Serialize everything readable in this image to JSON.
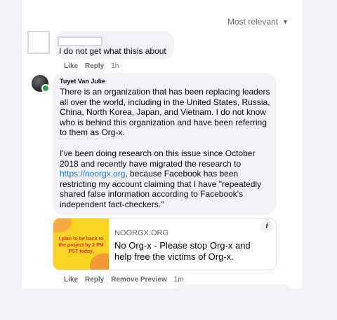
{
  "sort": {
    "label": "Most relevant"
  },
  "comments": [
    {
      "name": "",
      "text": "I do not get what thisis about",
      "actions": {
        "like": "Like",
        "reply": "Reply",
        "time": "1h"
      }
    },
    {
      "name": "Tuyet Van Julie",
      "paragraph1": "There is an organization that has been replacing leaders all over the world, including in the United States, Russia, China, North Korea, Japan, and Vietnam. I do not know who is behind this organization and have been referring to them as Org-x.",
      "paragraph2_before": "I've been doing research on this issue since October 2018 and recently have migrated the research to ",
      "paragraph2_link": "https://noorgx.org",
      "paragraph2_after": ", because Facebook has been restricting my account claiming that I have \"repeatedly shared false information according to Facebook's independent fact-checkers.\"",
      "preview": {
        "thumbnail_text": "I plan to be back to the project by 2 PM PST today.",
        "domain": "NOORGX.ORG",
        "title": "No Org-x - Please stop Org-x and help free the victims of Org-x.",
        "info_icon": "i"
      },
      "actions": {
        "like": "Like",
        "reply": "Reply",
        "remove_preview": "Remove Preview",
        "time": "1m"
      }
    }
  ],
  "icons": {
    "sort_caret": "chevron-down-icon",
    "info": "info-icon",
    "online": "online-status-icon"
  },
  "colors": {
    "link": "#216fdb",
    "online": "#31a24c",
    "thumbnail_bg": "#f7d322",
    "thumbnail_text": "#d2342b"
  }
}
